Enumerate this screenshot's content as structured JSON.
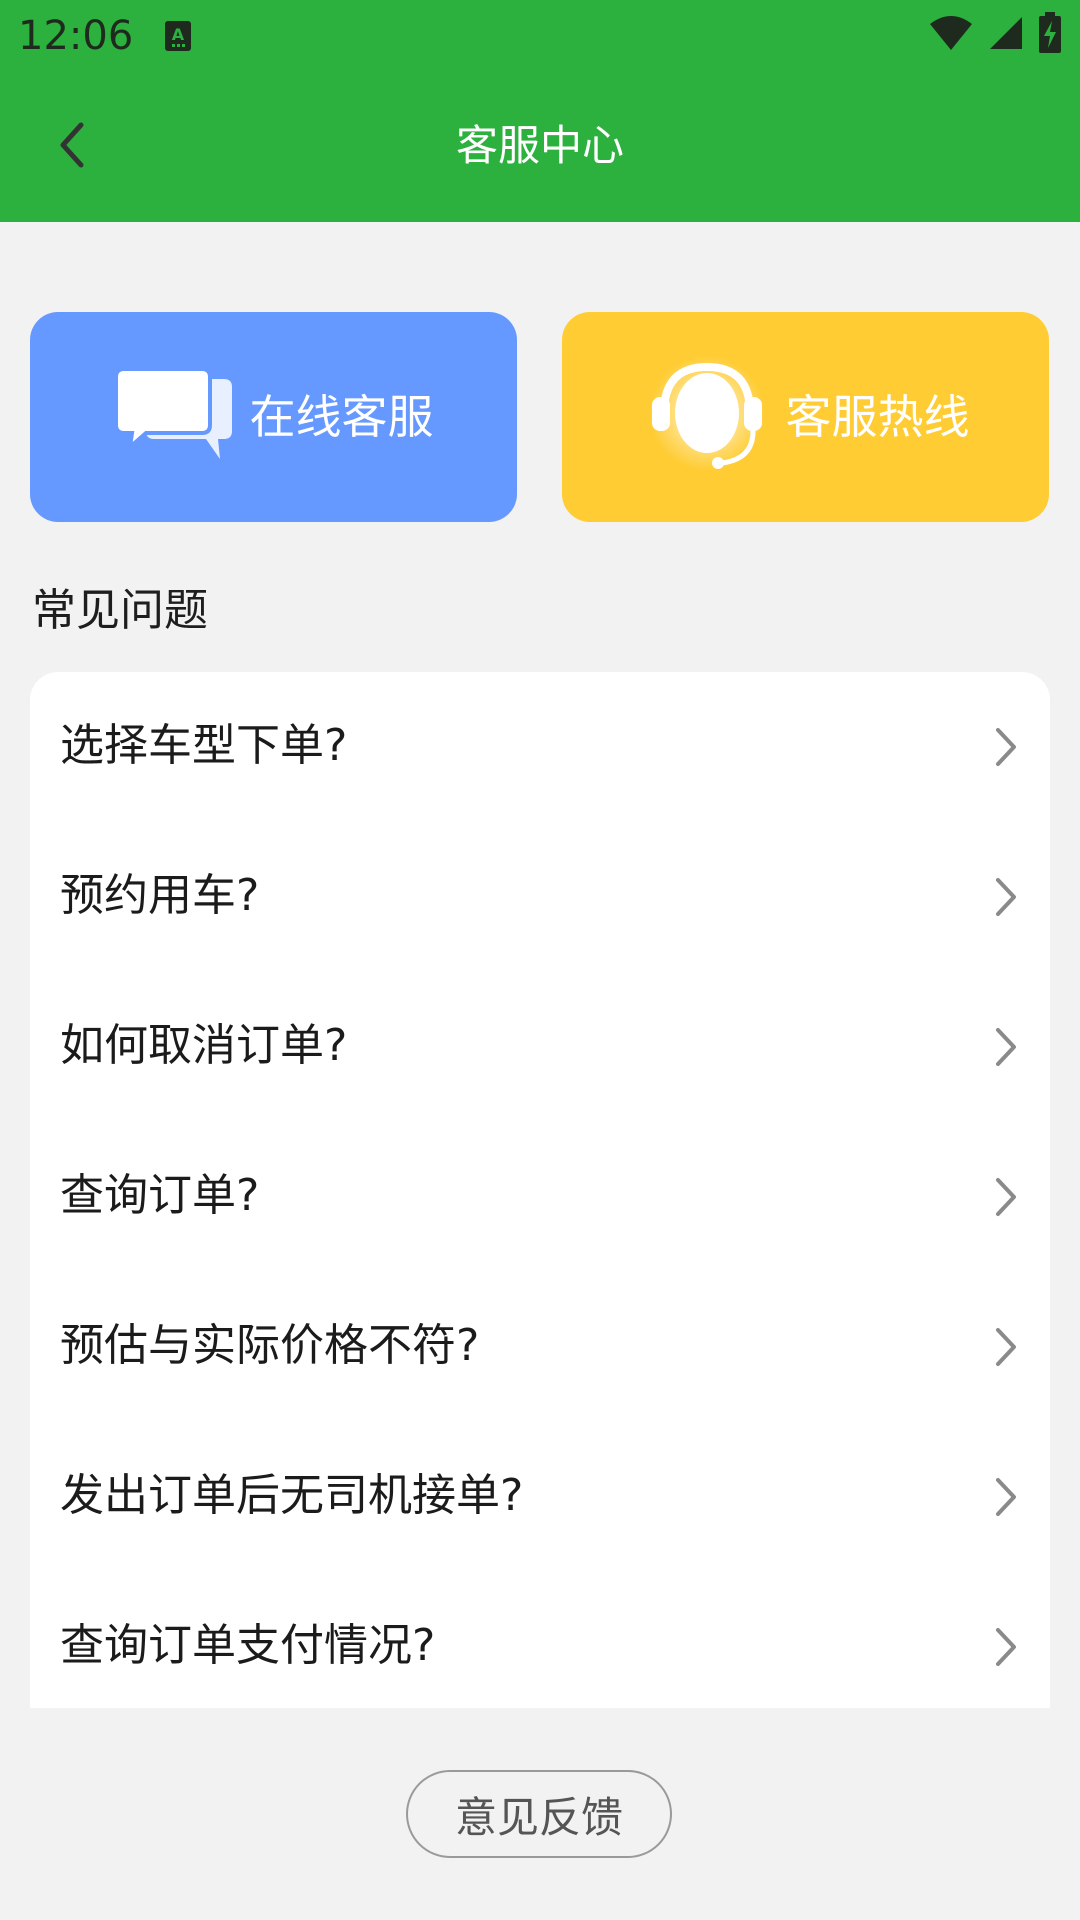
{
  "status_bar": {
    "time": "12:06",
    "icons": [
      "notification-a-icon",
      "wifi-icon",
      "cell-signal-icon",
      "battery-charging-icon"
    ]
  },
  "app_bar": {
    "title": "客服中心",
    "back_icon": "chevron-left-icon"
  },
  "service_buttons": {
    "online": {
      "label": "在线客服",
      "icon": "chat-bubbles-icon",
      "color": "#6699ff"
    },
    "hotline": {
      "label": "客服热线",
      "icon": "headset-icon",
      "color": "#ffcc33"
    }
  },
  "faq": {
    "title": "常见问题",
    "items": [
      {
        "label": "选择车型下单?"
      },
      {
        "label": "预约用车?"
      },
      {
        "label": "如何取消订单?"
      },
      {
        "label": "查询订单?"
      },
      {
        "label": "预估与实际价格不符?"
      },
      {
        "label": "发出订单后无司机接单?"
      },
      {
        "label": "查询订单支付情况?"
      }
    ]
  },
  "feedback_button": {
    "label": "意见反馈"
  },
  "colors": {
    "brand_green": "#2cb03e",
    "background": "#f2f2f2"
  }
}
